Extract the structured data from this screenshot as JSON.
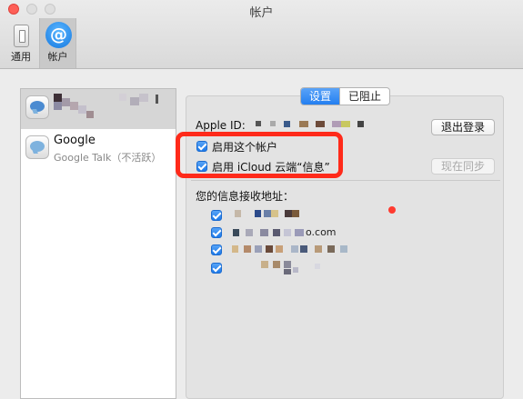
{
  "window": {
    "title": "帐户"
  },
  "toolbar": {
    "general_label": "通用",
    "accounts_label": "帐户",
    "accounts_icon_glyph": "@"
  },
  "accounts": [
    {
      "name": "",
      "sub": ""
    },
    {
      "name": "Google",
      "sub": "Google Talk（不活跃）"
    }
  ],
  "tabs": {
    "settings": "设置",
    "blocked": "已阻止"
  },
  "detail": {
    "apple_id_label": "Apple ID:",
    "logout_button": "退出登录",
    "enable_account": "启用这个帐户",
    "enable_icloud": "启用 iCloud 云端“信息”",
    "sync_now_button": "现在同步",
    "receive_title": "您的信息接收地址：",
    "address_fragment": "o.com"
  },
  "colors": {
    "accent": "#237ff0",
    "highlight": "#ff2a1a",
    "dot": "#ff3b30"
  }
}
